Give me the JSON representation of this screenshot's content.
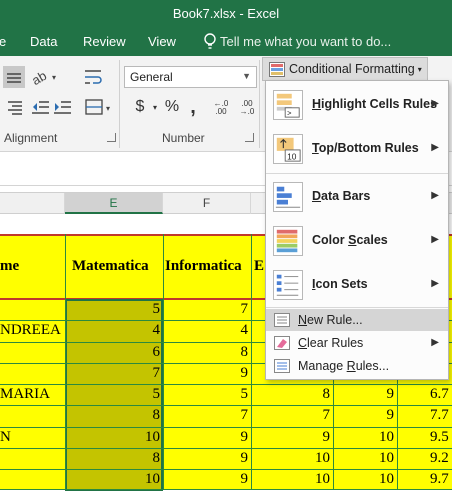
{
  "window": {
    "title": "Book7.xlsx - Excel"
  },
  "tabs": [
    {
      "label": "e"
    },
    {
      "label": "Data"
    },
    {
      "label": "Review"
    },
    {
      "label": "View"
    }
  ],
  "tell_me": {
    "placeholder": "Tell me what you want to do..."
  },
  "ribbon": {
    "number_format": "General",
    "currency_symbol": "$",
    "percent_symbol": "%",
    "comma_symbol": ",",
    "inc_decimal": "←.0 .00",
    "dec_decimal": ".00 →.0",
    "conditional_formatting": "Conditional Formatting",
    "groups": {
      "alignment": "Alignment",
      "number": "Number"
    }
  },
  "sheet": {
    "columns": [
      "E",
      "F"
    ],
    "headers": [
      "me",
      "Matematica",
      "Informatica",
      "E"
    ],
    "rows": [
      {
        "name": "",
        "e": "5",
        "f": "7",
        "g": "",
        "h": "",
        "i": ""
      },
      {
        "name": "NDREEA",
        "e": "4",
        "f": "4",
        "g": "",
        "h": "",
        "i": ""
      },
      {
        "name": "",
        "e": "6",
        "f": "8",
        "g": "",
        "h": "",
        "i": ""
      },
      {
        "name": "",
        "e": "7",
        "f": "9",
        "g": "",
        "h": "",
        "i": ""
      },
      {
        "name": "MARIA",
        "e": "5",
        "f": "5",
        "g": "8",
        "h": "9",
        "i": "6.7"
      },
      {
        "name": "",
        "e": "8",
        "f": "7",
        "g": "7",
        "h": "9",
        "i": "7.7"
      },
      {
        "name": "N",
        "e": "10",
        "f": "9",
        "g": "9",
        "h": "10",
        "i": "9.5"
      },
      {
        "name": "",
        "e": "8",
        "f": "9",
        "g": "10",
        "h": "10",
        "i": "9.2"
      },
      {
        "name": "",
        "e": "10",
        "f": "9",
        "g": "10",
        "h": "10",
        "i": "9.7"
      }
    ]
  },
  "menu": {
    "items": [
      {
        "pre": "",
        "acc": "H",
        "post": "ighlight Cells Rules"
      },
      {
        "pre": "",
        "acc": "T",
        "post": "op/Bottom Rules"
      },
      {
        "pre": "",
        "acc": "D",
        "post": "ata Bars"
      },
      {
        "pre": "Color ",
        "acc": "S",
        "post": "cales"
      },
      {
        "pre": "",
        "acc": "I",
        "post": "con Sets"
      }
    ],
    "new_rule": {
      "pre": "",
      "acc": "N",
      "post": "ew Rule..."
    },
    "clear_rules": {
      "pre": "",
      "acc": "C",
      "post": "lear Rules"
    },
    "manage_rules": {
      "pre": "Manage ",
      "acc": "R",
      "post": "ules..."
    },
    "topbottom_badge": "10"
  },
  "colors": {
    "excel_green": "#217346",
    "sheet_fill": "#ffff00",
    "selection_fill": "#c4c400",
    "grid_green": "#2c8a3e",
    "header_red": "#c0392b"
  }
}
